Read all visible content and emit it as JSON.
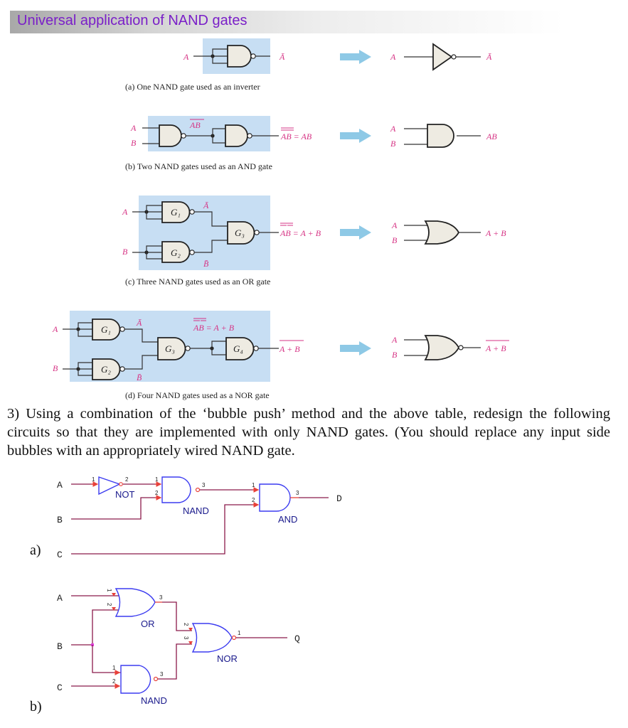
{
  "header": {
    "title": "Universal application of NAND gates"
  },
  "figures": {
    "a": {
      "caption": "(a) One NAND gate used as an inverter",
      "input": "A",
      "output": "Ā",
      "equiv_input": "A",
      "equiv_output": "Ā"
    },
    "b": {
      "caption": "(b) Two NAND gates used as an AND gate",
      "in1": "A",
      "in2": "B",
      "mid": "AB",
      "output": "AB = AB",
      "equiv_in1": "A",
      "equiv_in2": "B",
      "equiv_output": "AB"
    },
    "c": {
      "caption": "(c) Three NAND gates used as an OR gate",
      "in1": "A",
      "in2": "B",
      "g1": "G₁",
      "g2": "G₂",
      "g3": "G₃",
      "mid1": "Ā",
      "mid2": "B̄",
      "output": "AB = A + B",
      "equiv_in1": "A",
      "equiv_in2": "B",
      "equiv_output": "A + B"
    },
    "d": {
      "caption": "(d) Four NAND gates used as a NOR gate",
      "in1": "A",
      "in2": "B",
      "g1": "G₁",
      "g2": "G₂",
      "g3": "G₃",
      "g4": "G₄",
      "mid1": "Ā",
      "mid2": "B̄",
      "mid3": "AB = A + B",
      "output": "A + B",
      "equiv_in1": "A",
      "equiv_in2": "B",
      "equiv_output": "A + B"
    }
  },
  "question": {
    "text": "3) Using a combination of the ‘bubble push’ method and the above table, redesign the following circuits so that they are implemented with only NAND gates. (You should replace any input side bubbles with an appropriately wired NAND gate."
  },
  "circuit_a": {
    "part_label": "a)",
    "inputs": [
      "A",
      "B",
      "C"
    ],
    "output": "D",
    "gates": [
      {
        "type": "NOT",
        "pins": [
          "1",
          "2"
        ]
      },
      {
        "type": "NAND",
        "pins": [
          "1",
          "2",
          "3"
        ]
      },
      {
        "type": "AND",
        "pins": [
          "1",
          "2",
          "3"
        ]
      }
    ]
  },
  "circuit_b": {
    "part_label": "b)",
    "inputs": [
      "A",
      "B",
      "C"
    ],
    "output": "Q",
    "gates": [
      {
        "type": "OR",
        "pins": [
          "1",
          "2",
          "3"
        ]
      },
      {
        "type": "NOR",
        "pins": [
          "2",
          "3",
          "1"
        ]
      },
      {
        "type": "NAND",
        "pins": [
          "1",
          "2",
          "3"
        ]
      }
    ]
  }
}
